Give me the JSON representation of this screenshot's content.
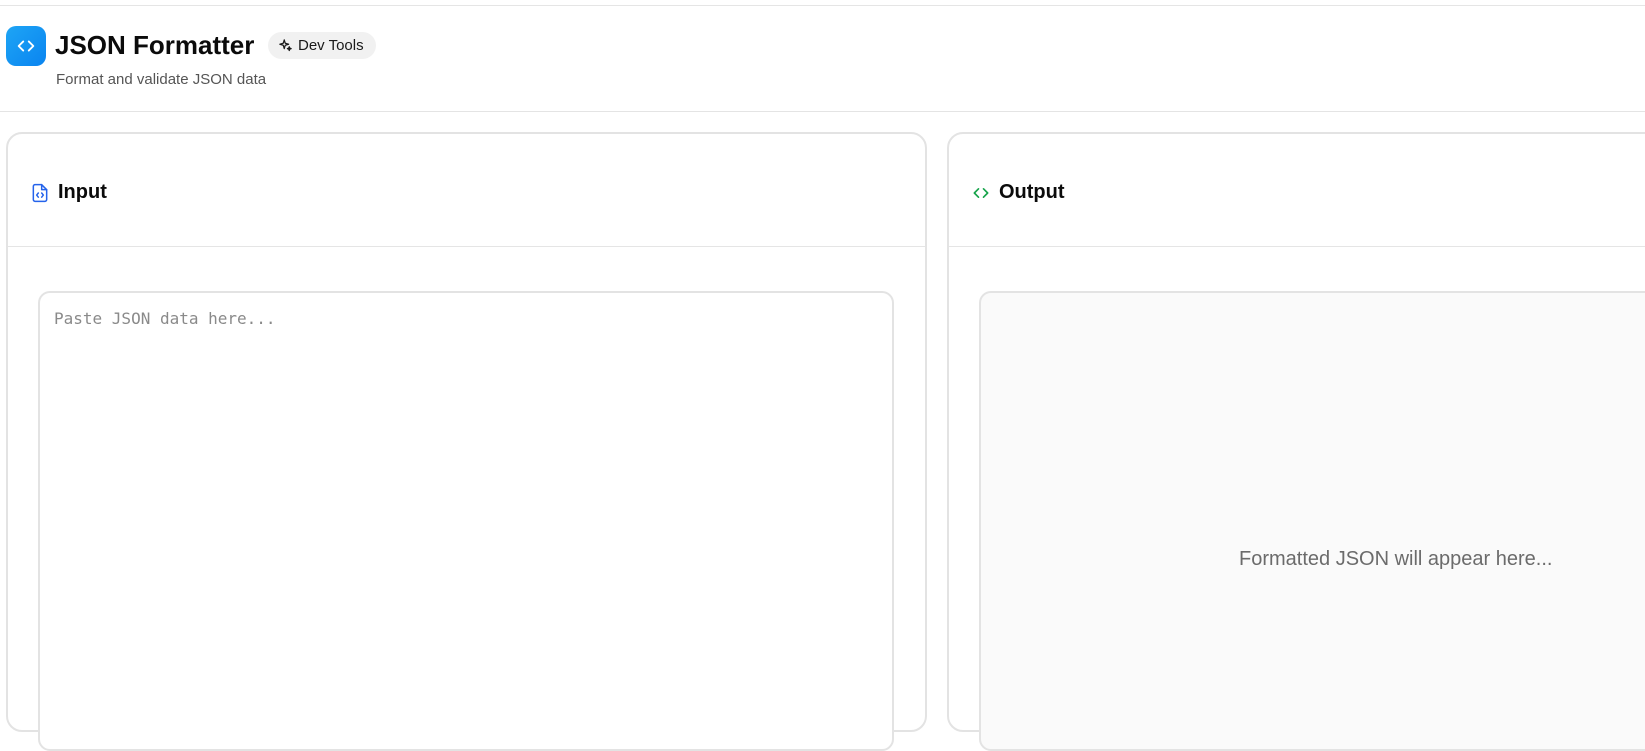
{
  "header": {
    "title": "JSON Formatter",
    "badge": "Dev Tools",
    "subtitle": "Format and validate JSON data",
    "app_icon": "code-brackets-icon",
    "badge_icon": "sparkles-icon"
  },
  "input_panel": {
    "title": "Input",
    "icon": "file-code-icon",
    "placeholder": "Paste JSON data here..."
  },
  "output_panel": {
    "title": "Output",
    "icon": "code-brackets-icon",
    "placeholder": "Formatted JSON will appear here..."
  },
  "colors": {
    "accent_blue": "#0a84f0",
    "input_icon": "#2563eb",
    "output_icon": "#16a34a",
    "border": "#e3e3e3"
  }
}
